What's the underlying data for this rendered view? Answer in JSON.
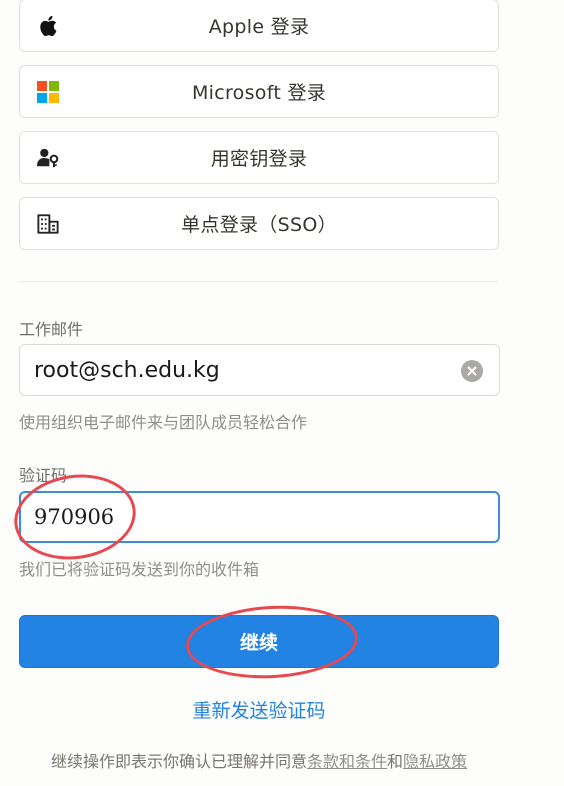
{
  "login_options": {
    "apple": {
      "label": "Apple 登录",
      "icon": "apple-logo-icon"
    },
    "microsoft": {
      "label": "Microsoft 登录",
      "icon": "microsoft-logo-icon"
    },
    "passkey": {
      "label": "用密钥登录",
      "icon": "passkey-person-key-icon"
    },
    "sso": {
      "label": "单点登录（SSO）",
      "icon": "building-icon"
    }
  },
  "email": {
    "label": "工作邮件",
    "value": "root@sch.edu.kg",
    "hint": "使用组织电子邮件来与团队成员轻松合作"
  },
  "verification": {
    "label": "验证码",
    "value": "970906",
    "hint": "我们已将验证码发送到你的收件箱"
  },
  "continue_label": "继续",
  "resend_label": "重新发送验证码",
  "terms": {
    "prefix": "继续操作即表示你确认已理解并同意",
    "terms_link": "条款和条件",
    "joiner": "和",
    "privacy_link": "隐私政策"
  },
  "colors": {
    "accent": "#2383e2",
    "annotation": "#e8484f"
  }
}
